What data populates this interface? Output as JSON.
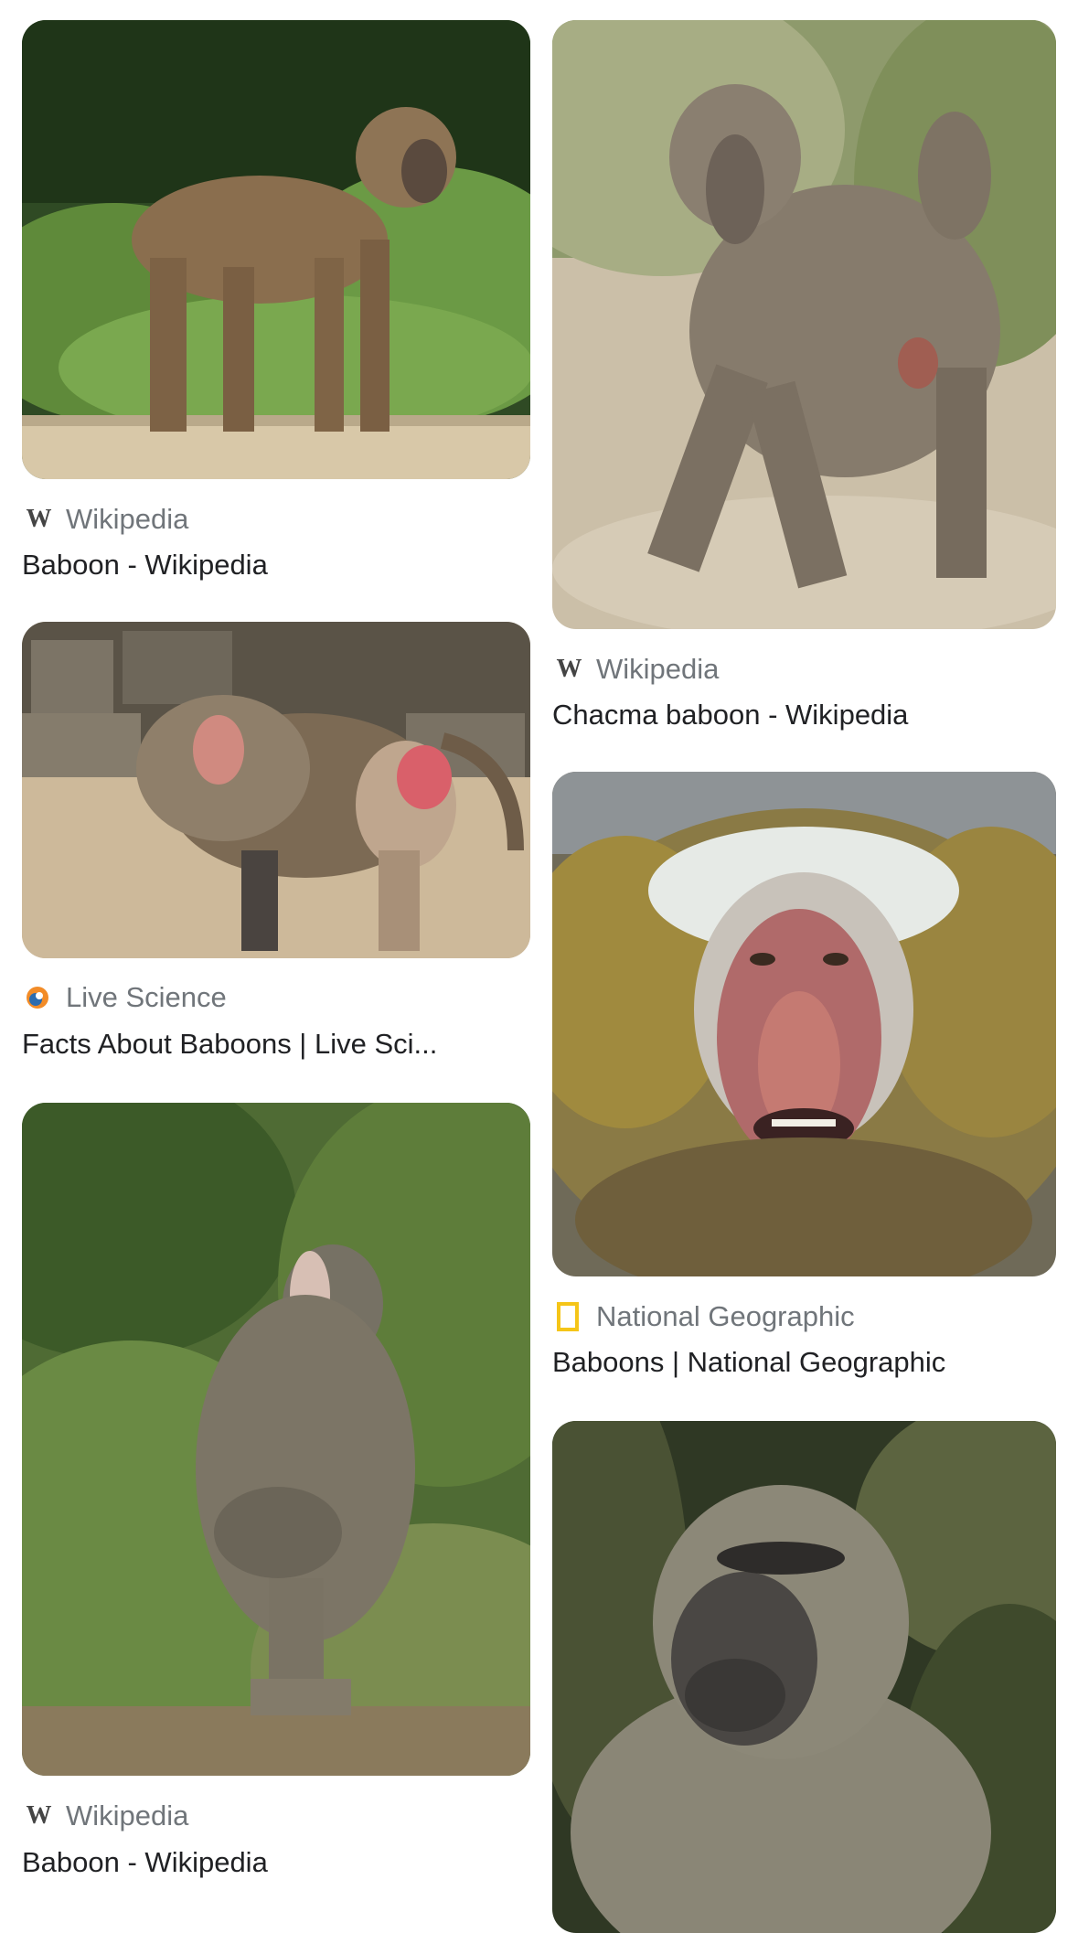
{
  "results": [
    {
      "source": "Wikipedia",
      "source_icon": "wikipedia-icon",
      "title": "Baboon - Wikipedia",
      "image": "olive baboon standing on ledge"
    },
    {
      "source": "Wikipedia",
      "source_icon": "wikipedia-icon",
      "title": "Chacma baboon - Wikipedia",
      "image": "chacma baboon walking on dirt road"
    },
    {
      "source": "Live Science",
      "source_icon": "live-science-icon",
      "title": "Facts About Baboons | Live Sci...",
      "image": "hamadryas baboon from behind"
    },
    {
      "source": "National Geographic",
      "source_icon": "national-geographic-icon",
      "title": "Baboons | National Geographic",
      "image": "close-up baboon face with open mouth"
    },
    {
      "source": "Wikipedia",
      "source_icon": "wikipedia-icon",
      "title": "Baboon - Wikipedia",
      "image": "baboon sitting and yawning in grass"
    },
    {
      "source": "",
      "source_icon": "",
      "title": "",
      "image": "baboon portrait in forest"
    }
  ],
  "colors": {
    "source_text": "#70757a",
    "title_text": "#202124",
    "natgeo_yellow": "#f5c518",
    "livescience_orange": "#f28c28",
    "livescience_blue": "#2b6cb0"
  }
}
